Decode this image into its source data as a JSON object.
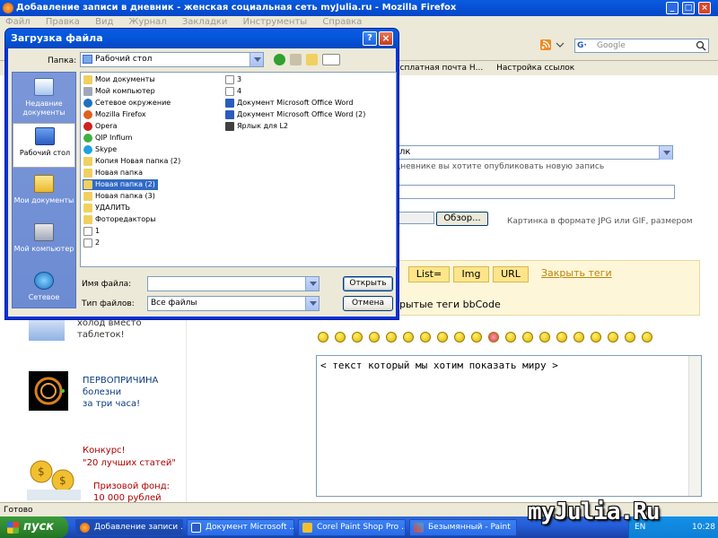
{
  "browser": {
    "title": "Добавление записи в дневник - женская социальная сеть myJulia.ru - Mozilla Firefox",
    "menu": [
      "Файл",
      "Правка",
      "Вид",
      "Журнал",
      "Закладки",
      "Инструменты",
      "Справка"
    ],
    "search_placeholder": "Google",
    "bookmarks": [
      "есплатная почта Н...",
      "Настройка ссылок"
    ],
    "status": "Готово"
  },
  "page": {
    "blog_select_value": "лк",
    "blog_hint": "дневнике вы хотите опубликовать новую запись",
    "browse_button": "Обзор...",
    "image_hint": "Картинка в формате JPG или GIF, размером",
    "tags": [
      "List=",
      "Img",
      "URL"
    ],
    "close_tags": "Закрыть теги",
    "bbcode_hint": "рытые теги bbCode",
    "editor_text": "< текст который мы хотим показать миру >",
    "ads": {
      "ad1": [
        "холод вместо",
        "таблеток!"
      ],
      "ad2": [
        "ПЕРВОПРИЧИНА",
        "болезни",
        "за три часа!"
      ],
      "ad3_title": "Конкурс!",
      "ad3_sub": "\"20 лучших статей\"",
      "ad3_prize": [
        "Призовой фонд:",
        "10 000 рублей"
      ]
    }
  },
  "dialog": {
    "title": "Загрузка файла",
    "folder_label": "Папка:",
    "folder_value": "Рабочий стол",
    "places": [
      {
        "label": "Недавние документы"
      },
      {
        "label": "Рабочий стол"
      },
      {
        "label": "Мои документы"
      },
      {
        "label": "Мой компьютер"
      },
      {
        "label": "Сетевое"
      }
    ],
    "files_col1": [
      "Мои документы",
      "Мой компьютер",
      "Сетевое окружение",
      "Mozilla Firefox",
      "Opera",
      "QIP Infium",
      "Skype",
      "Копия Новая папка (2)",
      "Новая папка",
      "Новая папка (2)",
      "Новая папка (3)",
      "УДАЛИТЬ",
      "Фоторедакторы",
      "1",
      "2"
    ],
    "files_col2": [
      "3",
      "4",
      "Документ Microsoft Office Word",
      "Документ Microsoft Office Word (2)",
      "Ярлык для L2"
    ],
    "filename_label": "Имя файла:",
    "filetype_label": "Тип файлов:",
    "filetype_value": "Все файлы",
    "open_button": "Открыть",
    "cancel_button": "Отмена"
  },
  "taskbar": {
    "start": "пуск",
    "tasks": [
      "Добавление записи ...",
      "Документ Microsoft ...",
      "Corel Paint Shop Pro ...",
      "Безымянный - Paint"
    ],
    "lang": "EN",
    "clock": "10:28"
  },
  "watermark": "myJulia.Ru"
}
